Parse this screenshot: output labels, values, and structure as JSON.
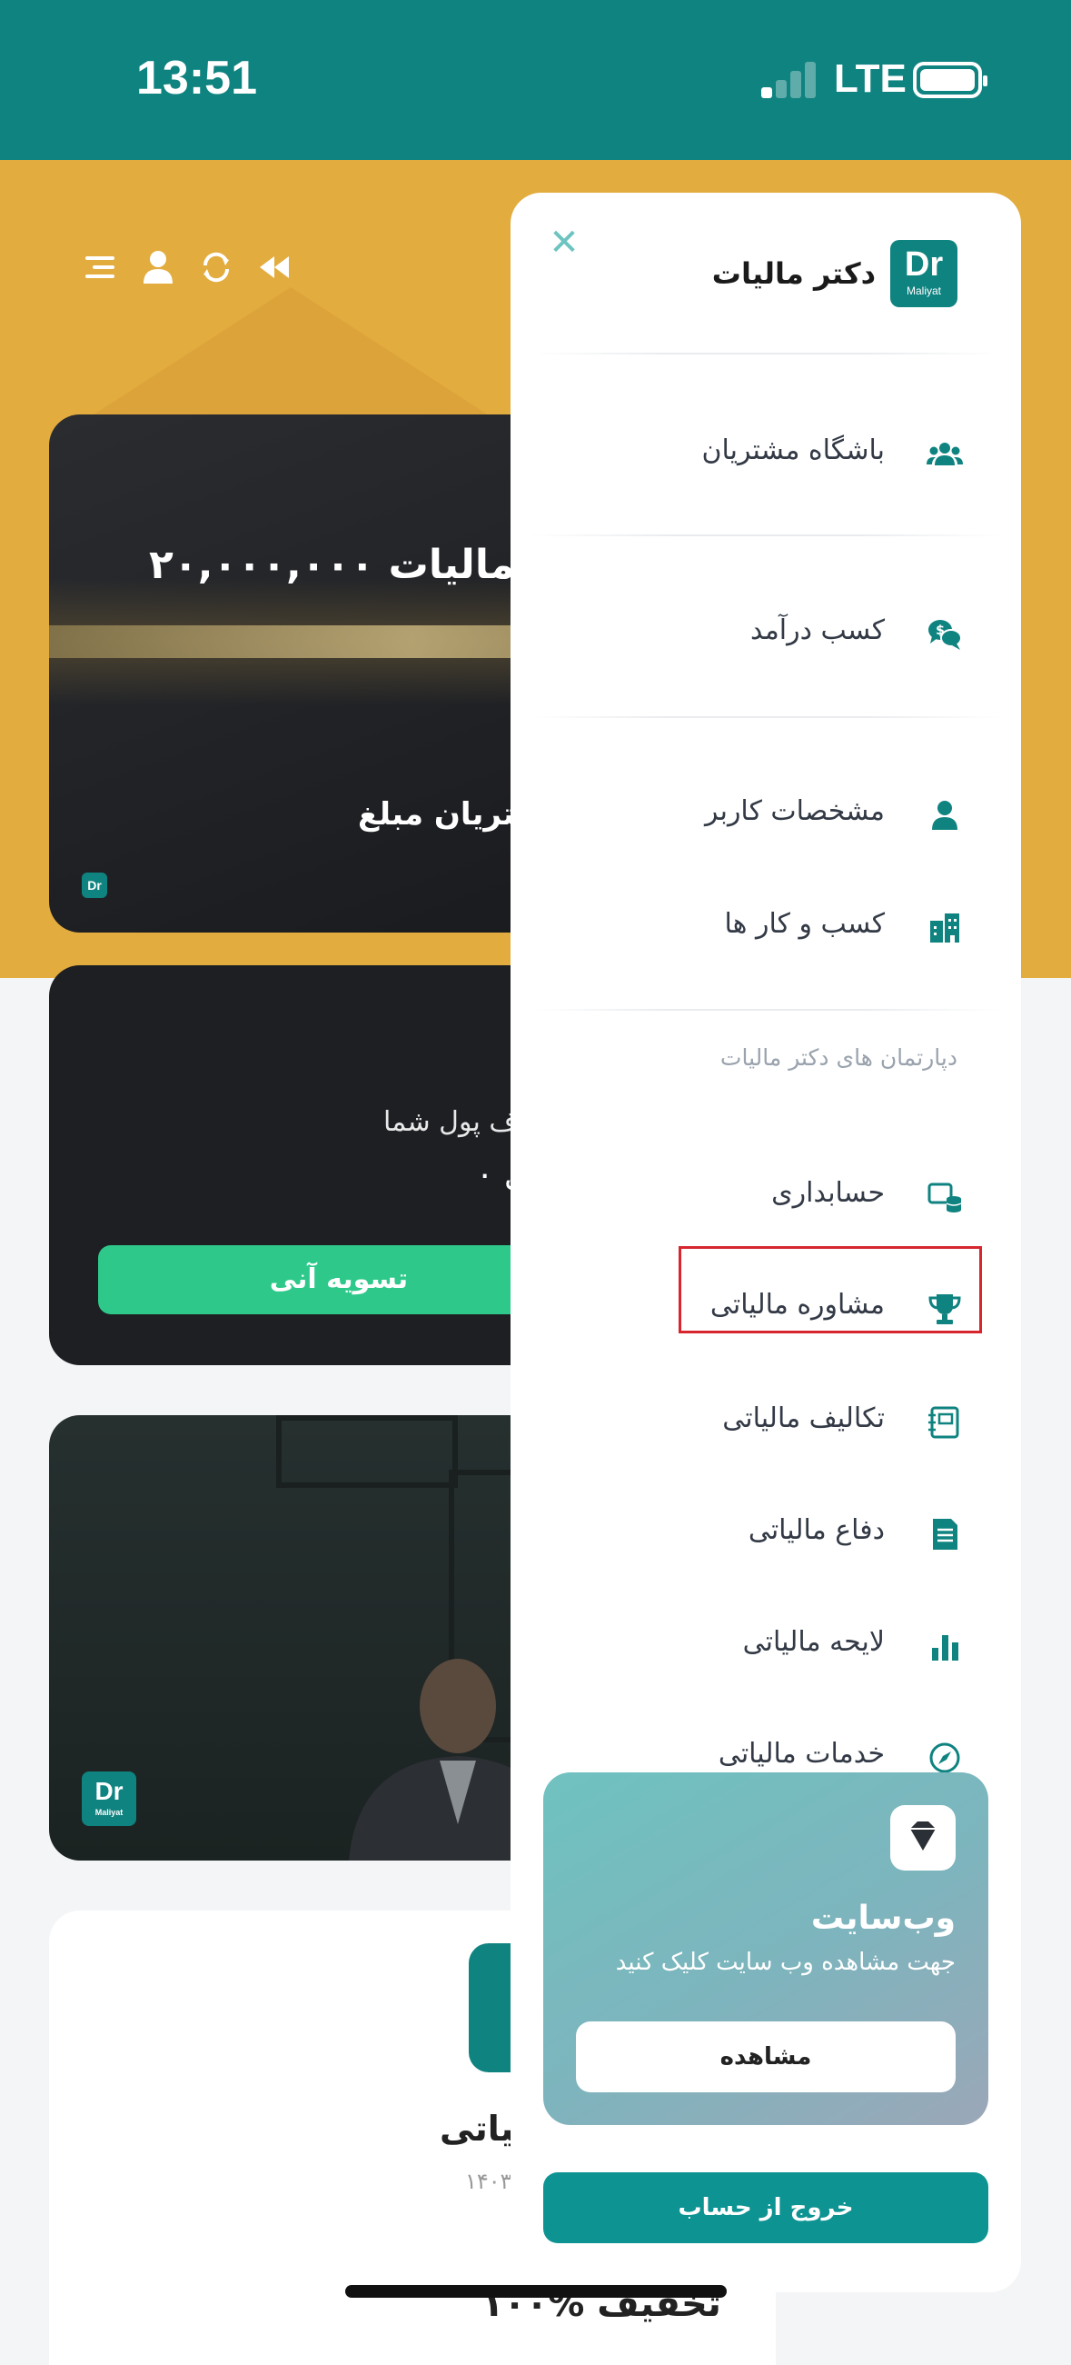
{
  "status_bar": {
    "time": "13:51",
    "network": "LTE"
  },
  "background": {
    "card1": {
      "title": "دکتر مالیات ۲۰,۰۰۰,۰۰۰",
      "subtitle": "شتریان مبلغ",
      "logo": "Dr"
    },
    "card2": {
      "line1": "ف پول شما",
      "line2": "۰ ریال",
      "button": "تسویه آنی"
    },
    "card3": {
      "logo": "Dr",
      "logo_sub": "Maliyat"
    },
    "card4": {
      "title": "الیاتی",
      "year": "۱۴۰۳",
      "discount": "۱۰۰% تخفیف"
    }
  },
  "drawer": {
    "brand": {
      "name": "دکتر مالیات",
      "logo": "Dr",
      "logo_sub": "Maliyat"
    },
    "items": [
      {
        "label": "باشگاه مشتریان",
        "icon": "users-icon"
      },
      {
        "label": "کسب درآمد",
        "icon": "money-chat-icon"
      },
      {
        "label": "مشخصات کاربر",
        "icon": "user-icon"
      },
      {
        "label": "کسب و کار ها",
        "icon": "building-icon"
      }
    ],
    "departments_heading": "دپارتمان های دکتر مالیات",
    "departments": [
      {
        "label": "حسابداری",
        "icon": "accounting-icon"
      },
      {
        "label": "مشاوره مالیاتی",
        "icon": "trophy-icon"
      },
      {
        "label": "تکالیف مالیاتی",
        "icon": "notebook-icon"
      },
      {
        "label": "دفاع مالیاتی",
        "icon": "document-icon"
      },
      {
        "label": "لایحه مالیاتی",
        "icon": "bar-chart-icon"
      },
      {
        "label": "خدمات مالیاتی",
        "icon": "compass-icon"
      }
    ],
    "website_card": {
      "title": "وب‌سایت",
      "description": "جهت مشاهده وب سایت کلیک کنید",
      "button": "مشاهده",
      "icon": "diamond-icon"
    },
    "logout": "خروج از حساب"
  },
  "colors": {
    "teal": "#0f8380",
    "gold": "#e3ac3e",
    "green": "#2ec98a",
    "highlight": "#d8262f"
  }
}
